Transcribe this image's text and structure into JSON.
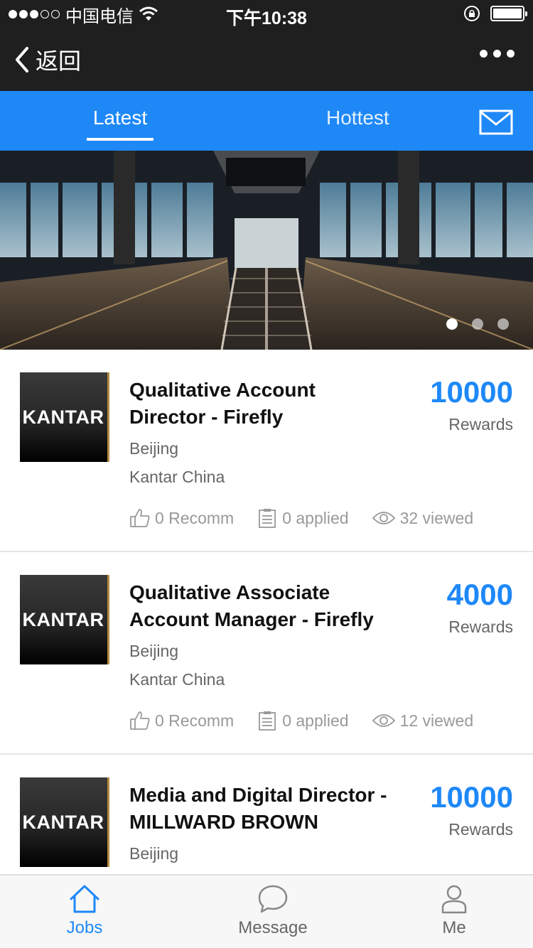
{
  "status_bar": {
    "carrier": "中国电信",
    "time": "下午10:38"
  },
  "nav": {
    "back_label": "返回",
    "icons": [
      "chevron-left-icon",
      "more-icon"
    ]
  },
  "tabs": {
    "items": [
      {
        "label": "Latest",
        "active": true
      },
      {
        "label": "Hottest",
        "active": false
      }
    ],
    "mail_icon": "mail-icon"
  },
  "banner": {
    "page_count": 3,
    "active_page": 1
  },
  "jobs": [
    {
      "logo_text": "KANTAR",
      "title_line1": "Qualitative Account",
      "title_line2": "Director - Firefly",
      "location": "Beijing",
      "company": "Kantar China",
      "reward": "10000",
      "reward_label": "Rewards",
      "recomm": "0 Recomm",
      "applied": "0 applied",
      "viewed": "32 viewed"
    },
    {
      "logo_text": "KANTAR",
      "title_line1": "Qualitative Associate",
      "title_line2": "Account Manager - Firefly",
      "location": "Beijing",
      "company": "Kantar China",
      "reward": "4000",
      "reward_label": "Rewards",
      "recomm": "0 Recomm",
      "applied": "0 applied",
      "viewed": "12 viewed"
    },
    {
      "logo_text": "KANTAR",
      "title_line1": "Media and Digital Director -",
      "title_line2": "MILLWARD BROWN",
      "location": "Beijing",
      "company": "",
      "reward": "10000",
      "reward_label": "Rewards",
      "recomm": "",
      "applied": "",
      "viewed": ""
    }
  ],
  "bottom_tabs": [
    {
      "label": "Jobs",
      "icon": "home-icon",
      "active": true
    },
    {
      "label": "Message",
      "icon": "chat-bubble-icon",
      "active": false
    },
    {
      "label": "Me",
      "icon": "person-icon",
      "active": false
    }
  ],
  "colors": {
    "accent": "#1e88f7",
    "dark_bar": "#1f1f1f"
  }
}
